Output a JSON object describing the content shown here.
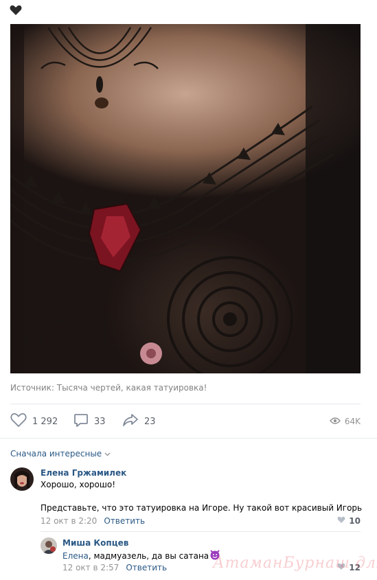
{
  "post": {
    "source_text": "Источник: Тысяча чертей, какая татуировка!",
    "likes": "1 292",
    "comments": "33",
    "shares": "23",
    "views": "64K"
  },
  "comments_sort": "Сначала интересные",
  "comments": [
    {
      "author": "Елена Гржамилек",
      "line1": "Хорошо, хорошо!",
      "line2": "Представьте, что это татуировка на Игоре. Ну такой вот красивый Игорь",
      "date": "12 окт в 2:20",
      "reply": "Ответить",
      "likes": "10"
    },
    {
      "author": "Миша Копцев",
      "mention": "Елена",
      "text": ", мадмуазель, да вы сатана",
      "emoji": "smiling-devil-emoji",
      "date": "12 окт в 2:57",
      "reply": "Ответить",
      "likes": "12"
    }
  ],
  "watermark": "АтаманБурнаш для ЯП",
  "colors": {
    "link": "#2a5885",
    "meta": "#939393",
    "divider": "#e7e8ec",
    "devil": "#9b3dbd"
  }
}
